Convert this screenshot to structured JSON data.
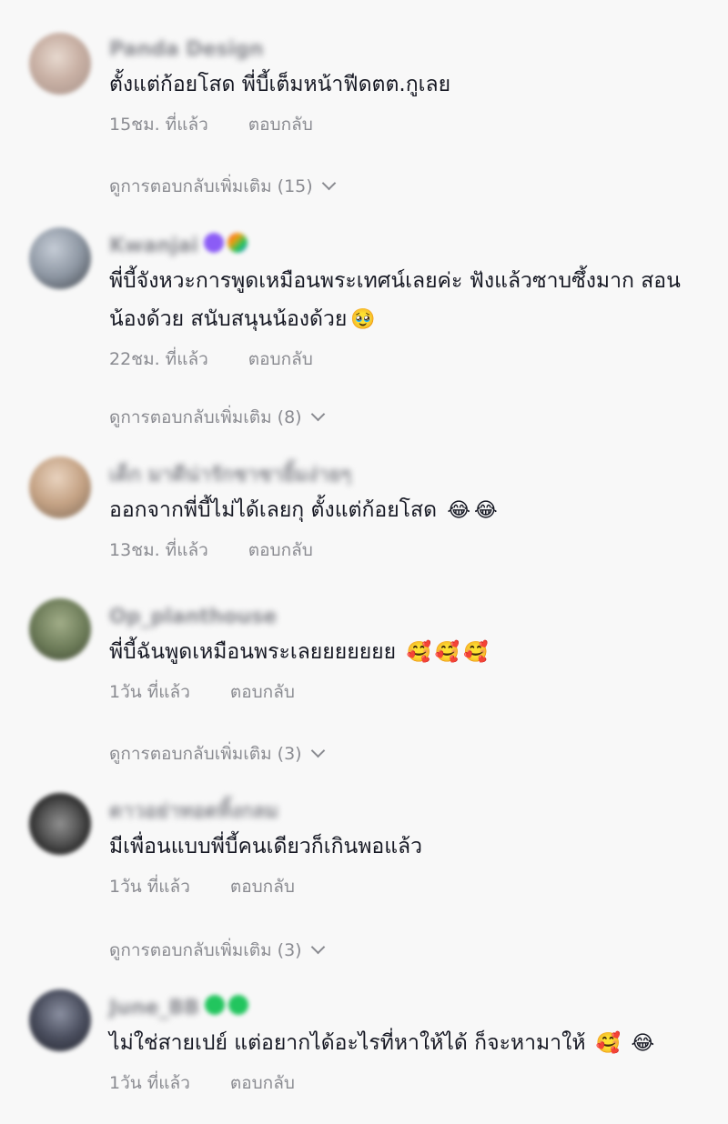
{
  "labels": {
    "reply": "ตอบกลับ"
  },
  "comments": [
    {
      "username": "Panda Design",
      "text": "ตั้งแต่ก้อยโสด พี่บี้เต็มหน้าฟีดตต.กูเลย",
      "time": "15ชม. ที่แล้ว",
      "more_replies": "ดูการตอบกลับเพิ่มเติม (15)",
      "emojis": []
    },
    {
      "username": "Kwanjai",
      "text": "พี่บี้จังหวะการพูดเหมือนพระเทศน์เลยค่ะ ฟังแล้วซาบซึ้งมาก สอนน้องด้วย สนับสนุนน้องด้วย",
      "time": "22ชม. ที่แล้ว",
      "more_replies": "ดูการตอบกลับเพิ่มเติม (8)",
      "emojis": [
        "🥹"
      ]
    },
    {
      "username": "เด็ก มาดีน่ารักชาชายิ้มง่ายๆ",
      "text": "ออกจากพี่บี้ไม่ได้เลยกุ ตั้งแต่ก้อยโสด",
      "time": "13ชม. ที่แล้ว",
      "more_replies": "",
      "emojis": [
        "😂",
        "😂"
      ]
    },
    {
      "username": "Op_planthouse",
      "text": "พี่บี้ฉันพูดเหมือนพระเลยยยยยยย",
      "time": "1วัน ที่แล้ว",
      "more_replies": "ดูการตอบกลับเพิ่มเติม (3)",
      "emojis": [
        "🥰",
        "🥰",
        "🥰"
      ]
    },
    {
      "username": "ดาวอย่าทอดทิ้งกลม",
      "text": "มีเพื่อนแบบพี่บี้คนเดียวก็เกินพอแล้ว",
      "time": "1วัน ที่แล้ว",
      "more_replies": "ดูการตอบกลับเพิ่มเติม (3)",
      "emojis": []
    },
    {
      "username": "June_BB",
      "text": "ไม่ใช่สายเปย์ แต่อยากได้อะไรที่หาให้ได้ ก็จะหามาให้",
      "time": "1วัน ที่แล้ว",
      "more_replies": "",
      "emojis": [
        "🥰",
        "😂"
      ]
    }
  ],
  "colors": {
    "background": "#f8f8f8",
    "text": "#161823",
    "secondary": "#8a8b91",
    "badge_purple": "#8b5cf6",
    "badge_green": "#22c55e"
  }
}
